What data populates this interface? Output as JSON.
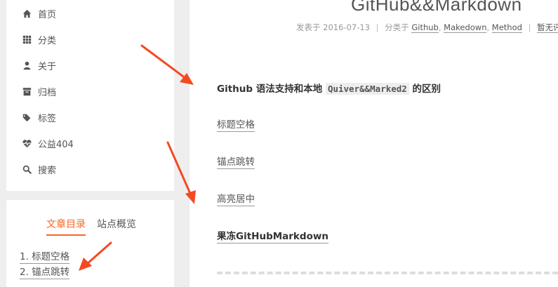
{
  "menu": {
    "items": [
      {
        "label": "首页",
        "icon": "home-icon"
      },
      {
        "label": "分类",
        "icon": "grid-icon"
      },
      {
        "label": "关于",
        "icon": "user-icon"
      },
      {
        "label": "归档",
        "icon": "archive-icon"
      },
      {
        "label": "标签",
        "icon": "tags-icon"
      },
      {
        "label": "公益404",
        "icon": "heartbeat-icon"
      },
      {
        "label": "搜索",
        "icon": "search-icon"
      }
    ]
  },
  "toc": {
    "tab_active": "文章目录",
    "tab_inactive": "站点概览",
    "entries": [
      "1. 标题空格",
      "2. 锚点跳转"
    ]
  },
  "post": {
    "title": "GitHub&&Markdown",
    "meta": {
      "posted_label": "发表于",
      "date": "2016-07-13",
      "category_label": "分类于",
      "categories": [
        "Github",
        "Makedown",
        "Method"
      ],
      "comments": "暂无评论"
    },
    "intro_prefix": "Github 语法支持和本地",
    "intro_code": "Quiver&&Marked2",
    "intro_suffix": "的区别",
    "sections": [
      "标题空格",
      "锚点跳转",
      "高亮居中",
      "果冻GitHubMarkdown"
    ]
  },
  "colors": {
    "accent": "#fc6423",
    "annotation_arrow": "#f44a23"
  }
}
